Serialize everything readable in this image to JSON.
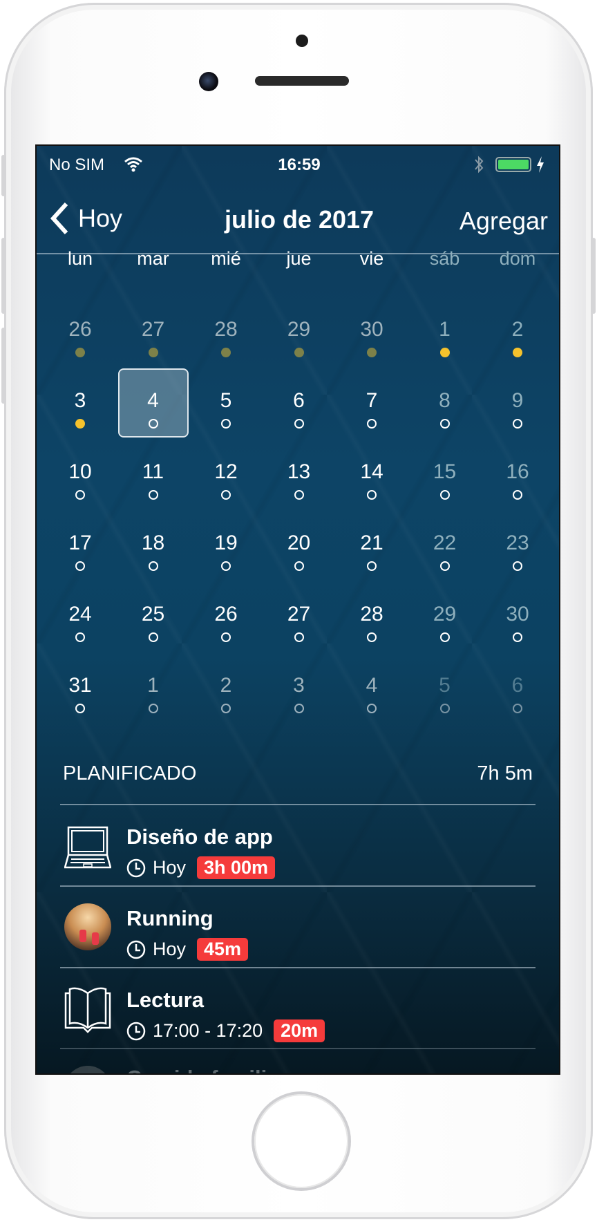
{
  "status_bar": {
    "carrier": "No SIM",
    "time": "16:59",
    "battery_color": "#4cd964"
  },
  "nav": {
    "back_label": "Hoy",
    "title": "julio de 2017",
    "add_label": "Agregar"
  },
  "weekdays": [
    "lun",
    "mar",
    "mié",
    "jue",
    "vie",
    "sáb",
    "dom"
  ],
  "selected_day": "4",
  "weeks": [
    [
      {
        "d": "26",
        "m": true,
        "dot": "past"
      },
      {
        "d": "27",
        "m": true,
        "dot": "past"
      },
      {
        "d": "28",
        "m": true,
        "dot": "past"
      },
      {
        "d": "29",
        "m": true,
        "dot": "past"
      },
      {
        "d": "30",
        "m": true,
        "dot": "past"
      },
      {
        "d": "1",
        "dot": "done"
      },
      {
        "d": "2",
        "dot": "done"
      }
    ],
    [
      {
        "d": "3",
        "dot": "done"
      },
      {
        "d": "4",
        "dot": "hollow"
      },
      {
        "d": "5",
        "dot": "hollow"
      },
      {
        "d": "6",
        "dot": "hollow"
      },
      {
        "d": "7",
        "dot": "hollow"
      },
      {
        "d": "8",
        "dot": "hollow"
      },
      {
        "d": "9",
        "dot": "hollow"
      }
    ],
    [
      {
        "d": "10",
        "dot": "hollow"
      },
      {
        "d": "11",
        "dot": "hollow"
      },
      {
        "d": "12",
        "dot": "hollow"
      },
      {
        "d": "13",
        "dot": "hollow"
      },
      {
        "d": "14",
        "dot": "hollow"
      },
      {
        "d": "15",
        "dot": "hollow"
      },
      {
        "d": "16",
        "dot": "hollow"
      }
    ],
    [
      {
        "d": "17",
        "dot": "hollow"
      },
      {
        "d": "18",
        "dot": "hollow"
      },
      {
        "d": "19",
        "dot": "hollow"
      },
      {
        "d": "20",
        "dot": "hollow"
      },
      {
        "d": "21",
        "dot": "hollow"
      },
      {
        "d": "22",
        "dot": "hollow"
      },
      {
        "d": "23",
        "dot": "hollow"
      }
    ],
    [
      {
        "d": "24",
        "dot": "hollow"
      },
      {
        "d": "25",
        "dot": "hollow"
      },
      {
        "d": "26",
        "dot": "hollow"
      },
      {
        "d": "27",
        "dot": "hollow"
      },
      {
        "d": "28",
        "dot": "hollow"
      },
      {
        "d": "29",
        "dot": "hollow"
      },
      {
        "d": "30",
        "dot": "hollow"
      }
    ],
    [
      {
        "d": "31",
        "dot": "hollow"
      },
      {
        "d": "1",
        "m": true,
        "dot": "hollow"
      },
      {
        "d": "2",
        "m": true,
        "dot": "hollow"
      },
      {
        "d": "3",
        "m": true,
        "dot": "hollow"
      },
      {
        "d": "4",
        "m": true,
        "dot": "hollow"
      },
      {
        "d": "5",
        "m": true,
        "dot": "hollow"
      },
      {
        "d": "6",
        "m": true,
        "dot": "hollow"
      }
    ]
  ],
  "planned": {
    "label": "PLANIFICADO",
    "total": "7h 5m"
  },
  "items": [
    {
      "title": "Diseño de app",
      "when": "Hoy",
      "duration": "3h 00m",
      "icon": "laptop-icon"
    },
    {
      "title": "Running",
      "when": "Hoy",
      "duration": "45m",
      "icon": "running-photo"
    },
    {
      "title": "Lectura",
      "when": "17:00 - 17:20",
      "duration": "20m",
      "icon": "book-icon"
    },
    {
      "title": "Comida familiar"
    }
  ],
  "colors": {
    "badge": "#f53b3b",
    "dot_done": "#f5c22c",
    "dot_past": "#7d8149",
    "background": "#0d4466"
  }
}
